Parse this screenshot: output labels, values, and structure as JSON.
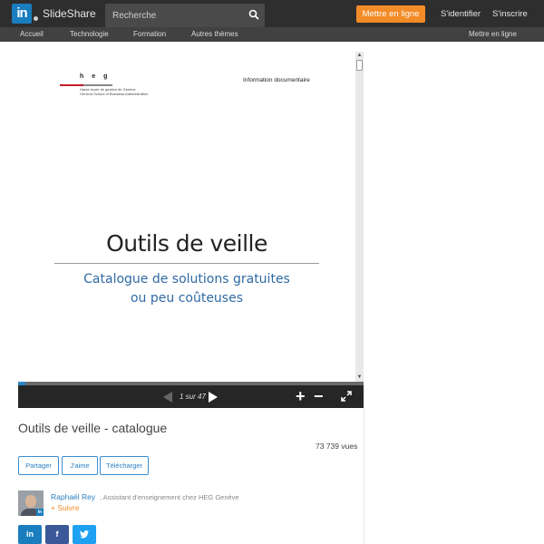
{
  "header": {
    "logo_mark": "in",
    "brand": "SlideShare",
    "search_placeholder": "Recherche",
    "upload_label": "Mettre en ligne",
    "login_label": "S'identifier",
    "signup_label": "S'inscrire"
  },
  "nav": {
    "items": [
      "Accueil",
      "Technologie",
      "Formation",
      "Autres thèmes"
    ],
    "right_label": "Mettre en ligne"
  },
  "slide": {
    "heg_letters": "heg",
    "heg_line1": "Haute école de gestion de Genève",
    "heg_line2": "Geneva School of Business Administration",
    "info_label": "Information documentaire",
    "title": "Outils de veille",
    "subtitle_line1": "Catalogue de solutions gratuites",
    "subtitle_line2": "ou peu coûteuses"
  },
  "player": {
    "page_text": "1 sur 47",
    "current_page": 1,
    "total_pages": 47,
    "progress": 0.021
  },
  "document": {
    "title": "Outils de veille - catalogue",
    "views": "73 739 vues"
  },
  "actions": {
    "share": "Partager",
    "like": "J'aime",
    "download": "Télécharger"
  },
  "author": {
    "name": "Raphaël Rey",
    "role": ", Assistant d'enseignement chez HEG Genève",
    "follow": "+ Suivre"
  },
  "social": {
    "linkedin": "in",
    "facebook": "f",
    "twitter_icon": "twitter-bird",
    "colors": {
      "linkedin": "#1a7dbd",
      "facebook": "#3b5998",
      "twitter": "#1ea1f2"
    }
  },
  "colors": {
    "accent_orange": "#f38b27",
    "link_blue": "#2a7ec0",
    "topbar": "#2e2e2e",
    "navbar": "#414141"
  }
}
